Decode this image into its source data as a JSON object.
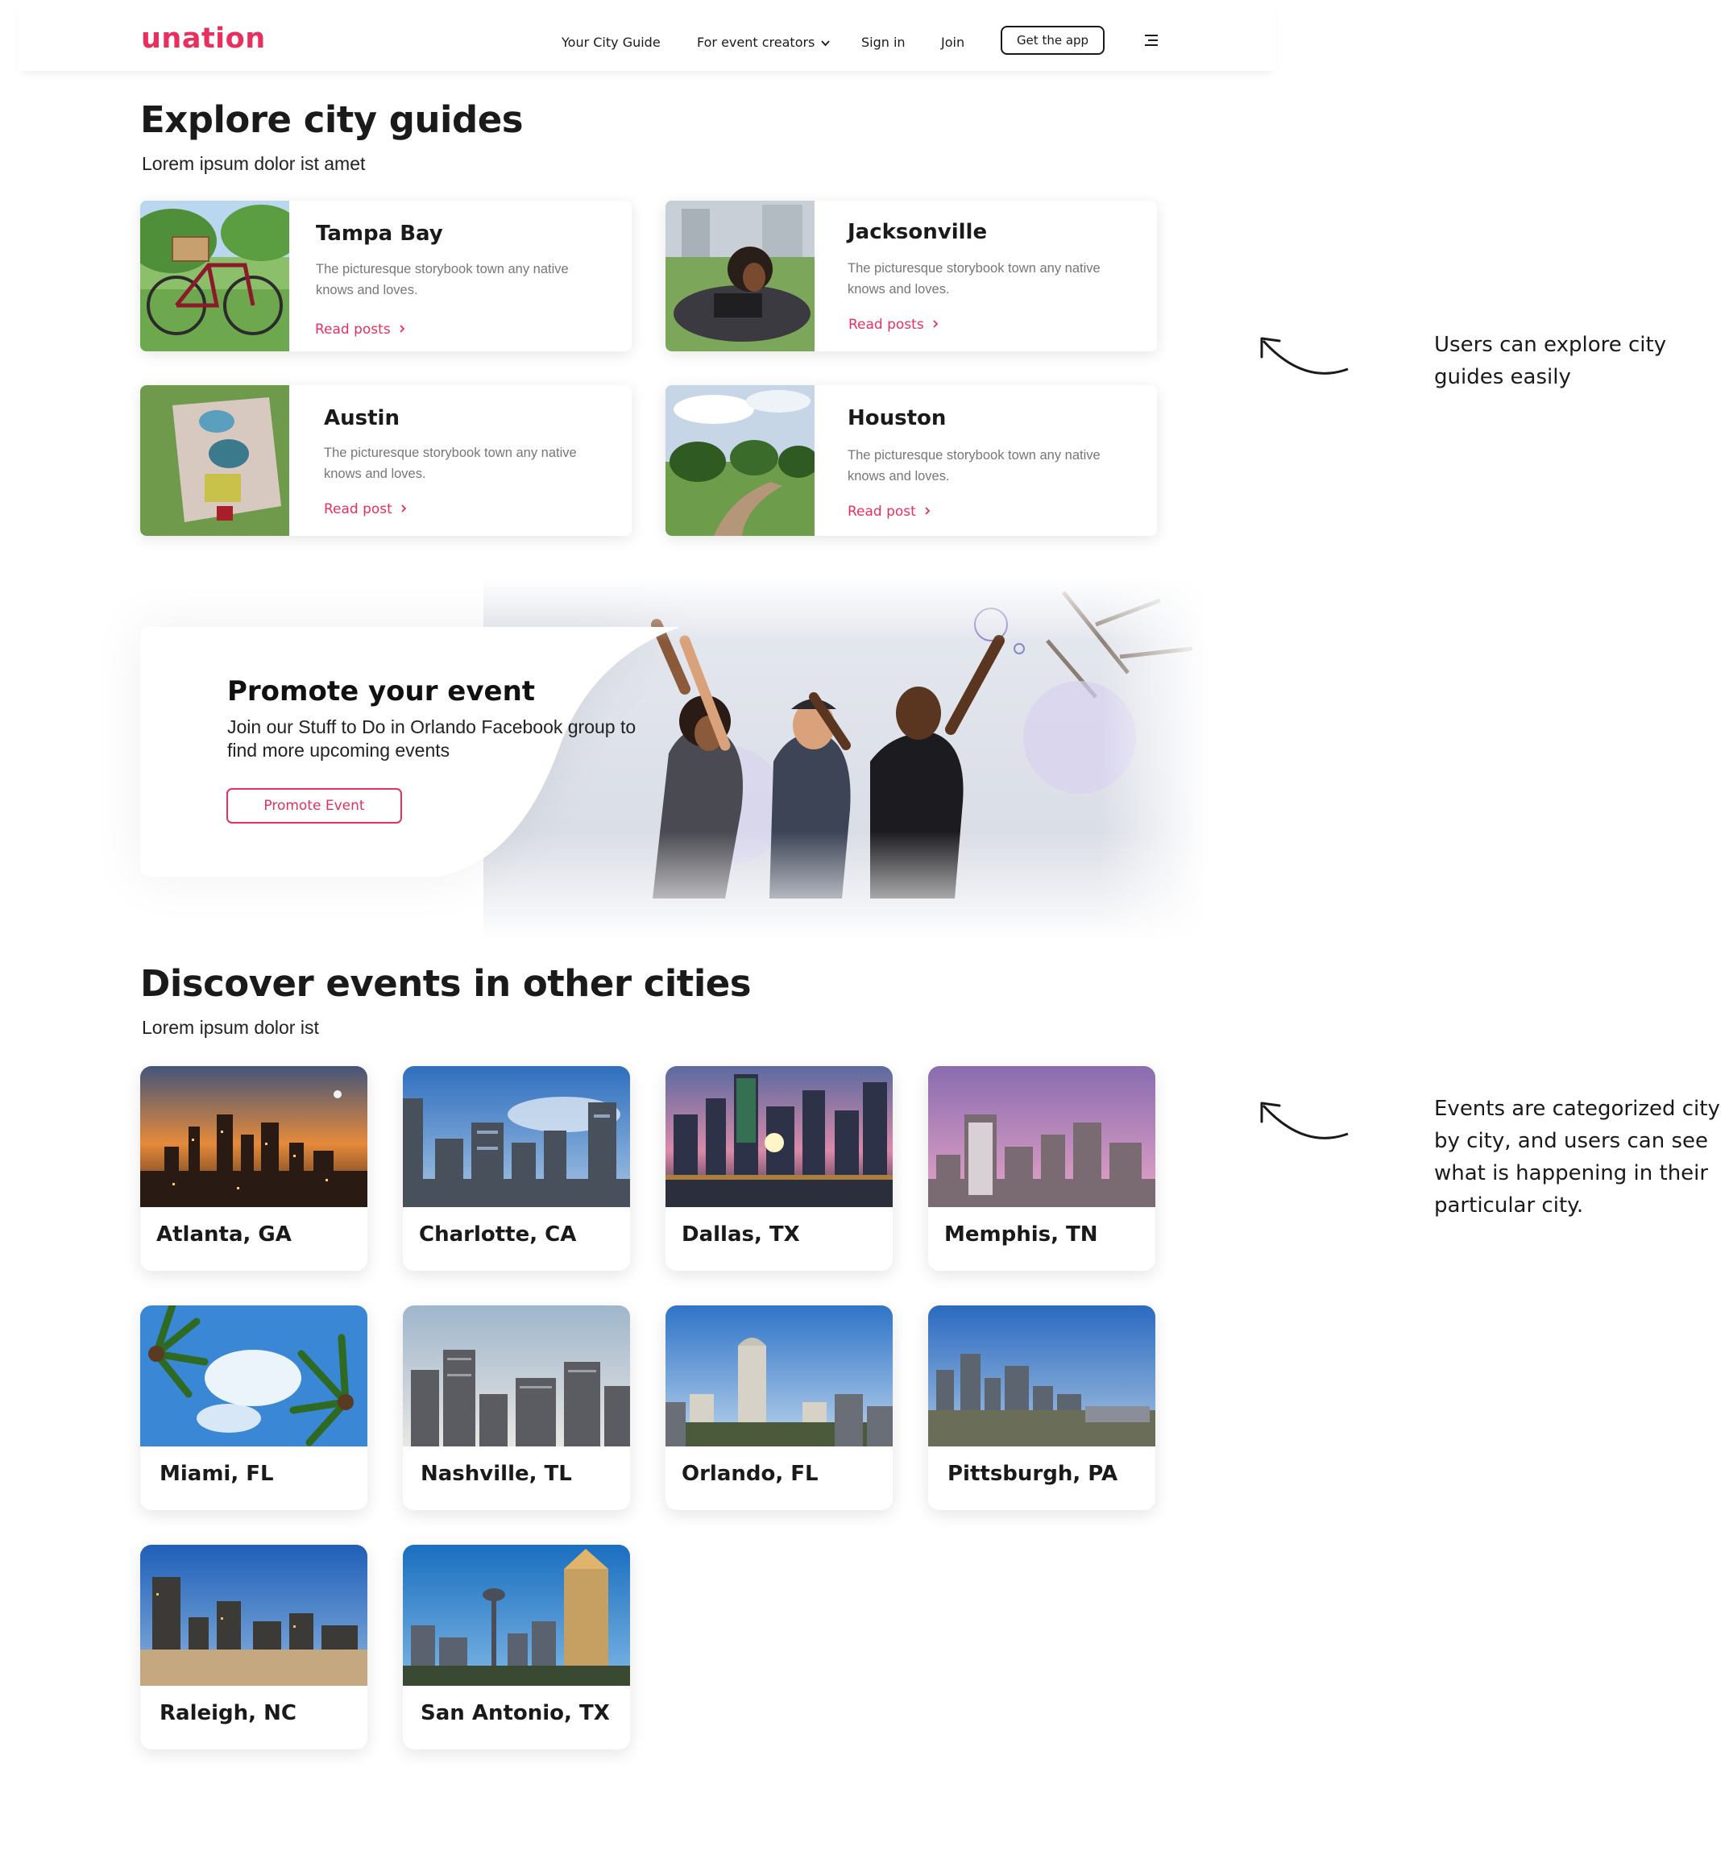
{
  "header": {
    "logo": "unation",
    "nav": [
      "Your City Guide",
      "For event creators",
      "Sign in",
      "Join"
    ],
    "app_button": "Get the app"
  },
  "guides": {
    "title": "Explore city guides",
    "subtitle": "Lorem ipsum dolor ist amet",
    "cards": [
      {
        "name": "Tampa Bay",
        "desc": "The picturesque storybook town any native knows and loves.",
        "link": "Read posts"
      },
      {
        "name": "Jacksonville",
        "desc": "The picturesque storybook town any native knows and loves.",
        "link": "Read posts"
      },
      {
        "name": "Austin",
        "desc": "The picturesque storybook town any native knows and loves.",
        "link": "Read post"
      },
      {
        "name": "Houston",
        "desc": "The picturesque storybook town any native knows and loves.",
        "link": "Read post"
      }
    ]
  },
  "promo": {
    "title": "Promote your event",
    "text": "Join our Stuff to Do in Orlando Facebook group to find more upcoming events",
    "button": "Promote Event"
  },
  "cities": {
    "title": "Discover events in other cities",
    "subtitle": "Lorem ipsum dolor ist",
    "items": [
      "Atlanta, GA",
      "Charlotte, CA",
      "Dallas, TX",
      "Memphis, TN",
      "Miami, FL",
      "Nashville, TL",
      "Orlando, FL",
      "Pittsburgh, PA",
      "Raleigh, NC",
      "San Antonio, TX"
    ]
  },
  "annotations": [
    "Users can explore city guides easily",
    "Events are categorized city by city, and users can see what is happening in their particular city."
  ],
  "colors": {
    "accent": "#e8305f",
    "text": "#1a1a1a",
    "muted": "#777777"
  },
  "icons": [
    "chevron-down-icon",
    "menu-icon",
    "chevron-right-icon",
    "curved-arrow-icon"
  ]
}
